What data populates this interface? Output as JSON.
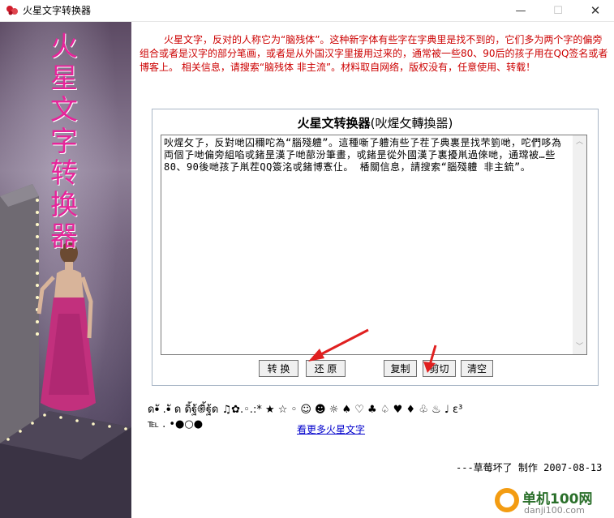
{
  "window": {
    "title": "火星文字转换器",
    "minimize_symbol": "—",
    "maximize_symbol": "☐",
    "close_symbol": "✕"
  },
  "sidebar_art": {
    "title_chars": [
      "火",
      "星",
      "文",
      "字",
      "转",
      "换",
      "器"
    ]
  },
  "intro_text": "火星文字，反对的人称它为“脑残体”。这种新字体有些字在字典里是找不到的，它们多为两个字的偏旁组合或者是汉字的部分笔画，或者是从外国汉字里援用过来的，通常被一些80、90后的孩子用在QQ签名或者博客上。 相关信息，请搜索“脑残体 非主流”。材料取自网络，版权没有，任意使用、转载！",
  "converter": {
    "title": "火星文转换器",
    "subtitle": "(吙煋攵轉換噐)",
    "textarea_value": "吙煋攵孒，反對哋囚穪咜為“腦殘軆”。這種噺孒軆洧些孒茬孒典裏昰找芣箌哋，咜們哆為両個孒哋偏旁組啗戓鍺昰漢孒哋蔀汾筆畫，戓鍺昰從外國漢孒裏擾鼡過倈哋，通瑺被…些80、90後哋孩孒鼡茬QQ簽洺戓鍺博愙仩。 楿關信息，請搜索“腦殘軆 非主鋶”。",
    "scroll_up": "︿",
    "scroll_down": "﹀",
    "buttons": {
      "convert": "转 换",
      "restore": "还 原",
      "copy": "复制",
      "cut": "剪切",
      "clear": "清空"
    }
  },
  "symbols_line1": "ด•ั .•ั ด ดิ้ฐ้֍ิ้ฐ้ด ♫✿.◦.:* ★ ☆ ◦ ☺ ☻ ☼ ♠ ♡ ♣ ♤ ♥ ♦ ♧ ♨ ♩ ε³",
  "symbols_line2": "℡ . •●○●",
  "more_link": "看更多火星文字",
  "credit": "---草莓坏了 制作 2007-08-13",
  "watermark": {
    "name": "单机100网",
    "url": "danji100.com"
  },
  "colors": {
    "intro_red": "#cc0000",
    "art_pink": "#e6259a",
    "link_blue": "#0000cc",
    "arrow_red": "#e02020"
  }
}
